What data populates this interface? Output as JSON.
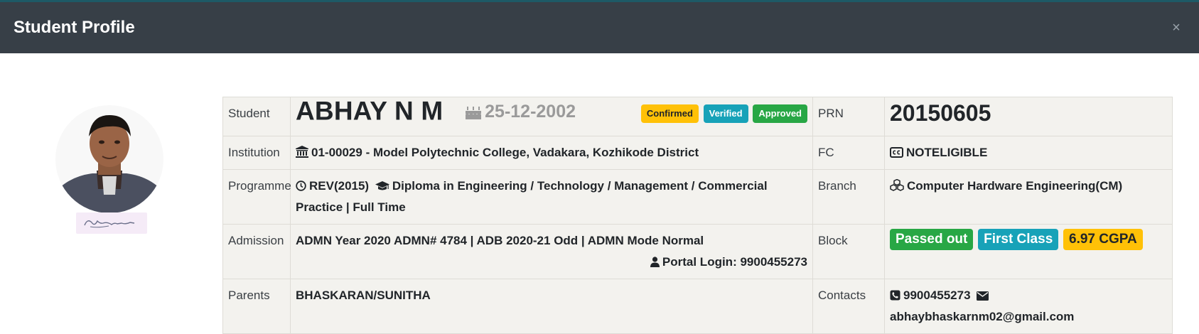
{
  "modal": {
    "title": "Student Profile",
    "close_icon": "close-icon"
  },
  "photo": {
    "alt": "Student photo"
  },
  "signature": {
    "alt": "Student signature"
  },
  "rows": {
    "student": {
      "label": "Student",
      "name": "ABHAY N M",
      "dob": "25-12-2002",
      "badges": [
        "Confirmed",
        "Verified",
        "Approved"
      ],
      "right_label": "PRN",
      "prn": "20150605"
    },
    "institution": {
      "label": "Institution",
      "value": "01-00029 - Model Polytechnic College, Vadakara, Kozhikode District",
      "right_label": "FC",
      "fc": "NOTELIGIBLE"
    },
    "programme": {
      "label": "Programme",
      "scheme": "REV(2015)",
      "value": "Diploma in Engineering / Technology / Management / Commercial Practice | Full Time",
      "right_label": "Branch",
      "branch": "Computer Hardware Engineering(CM)"
    },
    "admission": {
      "label": "Admission",
      "value": "ADMN Year 2020 ADMN# 4784 | ADB 2020-21 Odd | ADMN Mode Normal",
      "portal_login": "Portal Login: 9900455273",
      "right_label": "Block",
      "status_badges": [
        "Passed out",
        "First Class",
        "6.97 CGPA"
      ]
    },
    "parents": {
      "label": "Parents",
      "value": "BHASKARAN/SUNITHA",
      "right_label": "Contacts",
      "phone": "9900455273",
      "email": "abhaybhaskarnm02@gmail.com"
    }
  },
  "colors": {
    "header_bg": "#373f47",
    "table_bg": "#f3f2ee",
    "badge_yellow": "#ffc107",
    "badge_teal": "#17a2b8",
    "badge_green": "#28a745"
  }
}
